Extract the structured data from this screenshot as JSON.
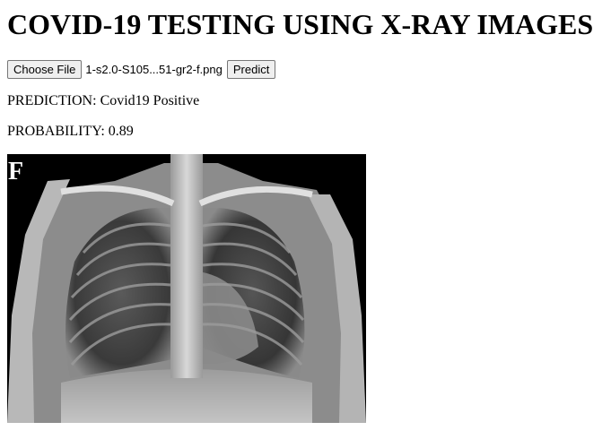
{
  "page": {
    "title": "COVID-19 TESTING USING X-RAY IMAGES"
  },
  "upload": {
    "choose_file_label": "Choose File",
    "file_name": "1-s2.0-S105...51-gr2-f.png",
    "predict_label": "Predict"
  },
  "result": {
    "prediction_label": "PREDICTION:",
    "prediction_value": "Covid19 Positive",
    "probability_label": "PROBABILITY:",
    "probability_value": "0.89"
  },
  "image": {
    "corner_letter": "F",
    "description_kind": "chest-xray"
  }
}
